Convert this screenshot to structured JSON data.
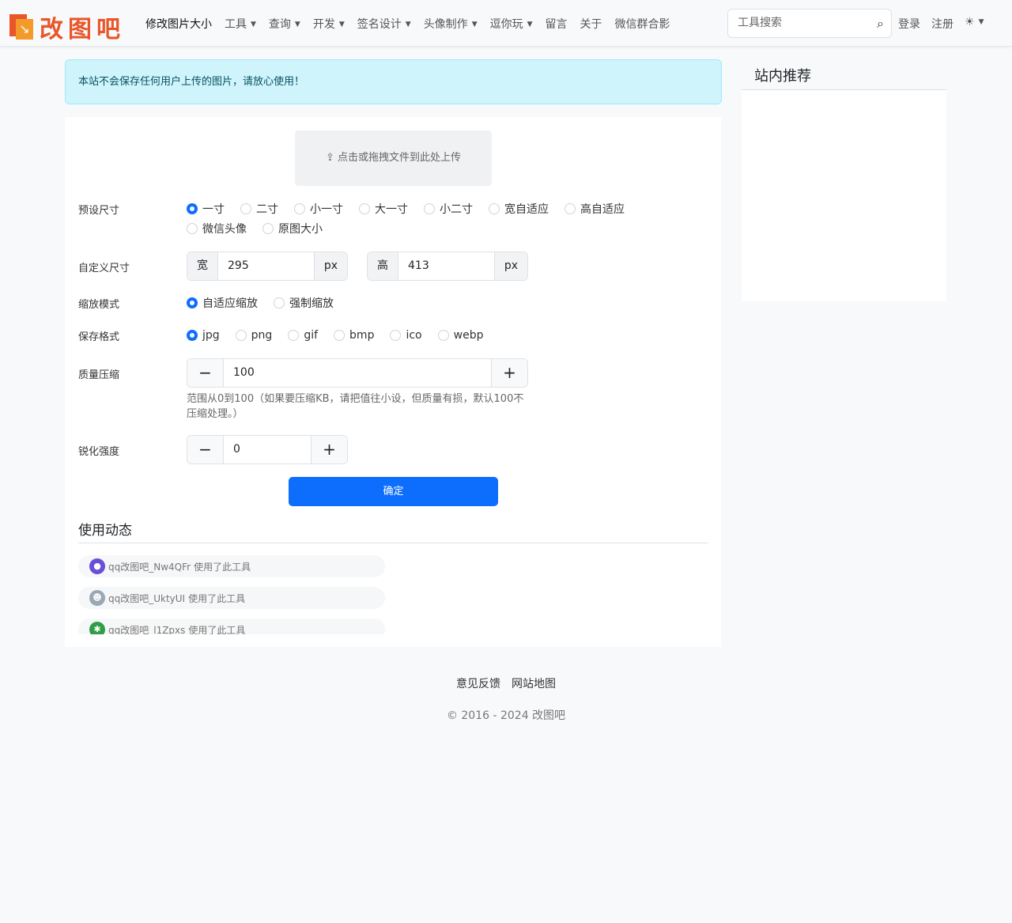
{
  "nav": {
    "logo": "改图吧",
    "items": [
      {
        "label": "修改图片大小",
        "caret": false
      },
      {
        "label": "工具",
        "caret": true
      },
      {
        "label": "查询",
        "caret": true
      },
      {
        "label": "开发",
        "caret": true
      },
      {
        "label": "签名设计",
        "caret": true
      },
      {
        "label": "头像制作",
        "caret": true
      },
      {
        "label": "逗你玩",
        "caret": true
      },
      {
        "label": "留言",
        "caret": false
      },
      {
        "label": "关于",
        "caret": false
      },
      {
        "label": "微信群合影",
        "caret": false
      }
    ],
    "search_placeholder": "工具搜索",
    "login": "登录",
    "register": "注册"
  },
  "alert": "本站不会保存任何用户上传的图片，请放心使用！",
  "upload": "点击或拖拽文件到此处上传",
  "form": {
    "preset_label": "预设尺寸",
    "presets": [
      "一寸",
      "二寸",
      "小一寸",
      "大一寸",
      "小二寸",
      "宽自适应",
      "高自适应",
      "微信头像",
      "原图大小"
    ],
    "preset_selected": 0,
    "custom_label": "自定义尺寸",
    "width_prefix": "宽",
    "width": "295",
    "height_prefix": "高",
    "height": "413",
    "unit": "px",
    "scale_label": "缩放模式",
    "scales": [
      "自适应缩放",
      "强制缩放"
    ],
    "scale_selected": 0,
    "format_label": "保存格式",
    "formats": [
      "jpg",
      "png",
      "gif",
      "bmp",
      "ico",
      "webp"
    ],
    "format_selected": 0,
    "quality_label": "质量压缩",
    "quality": "100",
    "quality_help": "范围从0到100（如果要压缩KB，请把值往小设，但质量有损，默认100不压缩处理。）",
    "sharpen_label": "锐化强度",
    "sharpen": "0",
    "minus": "−",
    "plus": "+",
    "submit": "确定"
  },
  "usage": {
    "title": "使用动态",
    "items": [
      {
        "user": "qq改图吧_Nw4QFr",
        "action": "使用了此工具"
      },
      {
        "user": "qq改图吧_UktyUI",
        "action": "使用了此工具"
      },
      {
        "user": "qq改图吧_l1Zpxs",
        "action": "使用了此工具"
      }
    ]
  },
  "sidebar": {
    "title": "站内推荐"
  },
  "footer": {
    "links": [
      "意见反馈",
      "网站地图"
    ],
    "copyright": "© 2016 - 2024 改图吧"
  }
}
